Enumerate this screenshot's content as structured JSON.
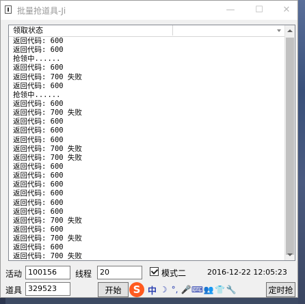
{
  "window": {
    "title": "批量抢道具-Ji"
  },
  "title_buttons": {
    "minimize": "—",
    "maximize": "☐",
    "close": "✕"
  },
  "list": {
    "columns": [
      "领取状态",
      ""
    ],
    "rows": [
      "返回代码: 600",
      "返回代码: 600",
      "抢领中......",
      "返回代码: 600",
      "返回代码: 700 失败",
      "返回代码: 600",
      "抢领中......",
      "返回代码: 600",
      "返回代码: 700 失败",
      "返回代码: 600",
      "返回代码: 600",
      "返回代码: 600",
      "返回代码: 700 失败",
      "返回代码: 700 失败",
      "返回代码: 600",
      "返回代码: 600",
      "返回代码: 600",
      "返回代码: 600",
      "返回代码: 600",
      "返回代码: 600",
      "返回代码: 700 失败",
      "返回代码: 600",
      "返回代码: 700 失败",
      "返回代码: 600",
      "返回代码: 700 失败"
    ]
  },
  "form": {
    "activity_label": "活动",
    "activity_value": "100156",
    "item_label": "道具",
    "item_value": "329523",
    "thread_label": "线程",
    "thread_value": "20",
    "mode_label": "模式二",
    "mode_checked": true,
    "datetime": "2016-12-22 12:05:23",
    "start_button": "开始",
    "timer_button": "定时抢"
  },
  "ime_toolbar": {
    "logo": "S",
    "items": [
      {
        "icon": "chinese-mode-icon",
        "glyph": "中"
      },
      {
        "icon": "moon-icon",
        "glyph": "☽"
      },
      {
        "icon": "punctuation-icon",
        "glyph": "°,"
      },
      {
        "icon": "microphone-icon",
        "glyph": "🎤"
      },
      {
        "icon": "keyboard-icon",
        "glyph": "⌨"
      },
      {
        "icon": "user-icon",
        "glyph": "👥"
      },
      {
        "icon": "shirt-icon",
        "glyph": "👕"
      },
      {
        "icon": "wrench-icon",
        "glyph": "🔧"
      }
    ]
  },
  "colors": {
    "ime_accent": "#2a3fb0",
    "ime_logo": "#ff5a1f",
    "window_bg": "#f0f0f0"
  }
}
